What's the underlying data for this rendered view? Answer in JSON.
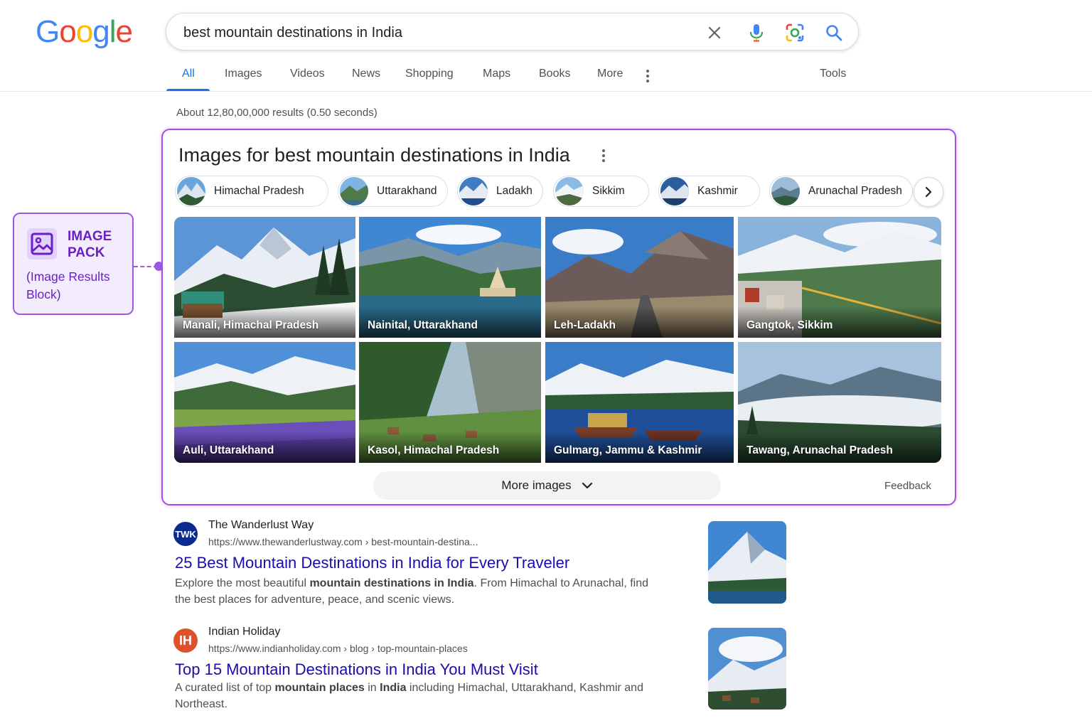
{
  "logo": {
    "letters": [
      "G",
      "o",
      "o",
      "g",
      "l",
      "e"
    ],
    "colors": [
      "#4285F4",
      "#EA4335",
      "#FBBC05",
      "#4285F4",
      "#34A853",
      "#EA4335"
    ]
  },
  "search": {
    "query": "best mountain destinations in India",
    "icons": [
      "close-icon",
      "mic-icon",
      "lens-icon",
      "search-icon"
    ]
  },
  "tabs": [
    "All",
    "Images",
    "Videos",
    "News",
    "Shopping",
    "Maps",
    "Books",
    "More"
  ],
  "tools_label": "Tools",
  "result_stats": "About 12,80,00,000 results (0.50 seconds)",
  "image_pack": {
    "title": "Images for best mountain destinations in India",
    "chips": [
      "Himachal Pradesh",
      "Uttarakhand",
      "Ladakh",
      "Sikkim",
      "Kashmir",
      "Arunachal Pradesh"
    ],
    "images": [
      "Manali, Himachal Pradesh",
      "Nainital, Uttarakhand",
      "Leh-Ladakh",
      "Gangtok, Sikkim",
      "Auli, Uttarakhand",
      "Kasol, Himachal Pradesh",
      "Gulmarg, Jammu & Kashmir",
      "Tawang, Arunachal Pradesh"
    ],
    "more_images": "More images",
    "feedback": "Feedback"
  },
  "callout": {
    "title_line1": "IMAGE",
    "title_line2": "PACK",
    "subtitle_line1": "(Image Results",
    "subtitle_line2": "Block)",
    "accent": "#9b59e0"
  },
  "results": [
    {
      "favicon_text": "TWK",
      "favicon_color": "#0b2a8f",
      "site": "The Wanderlust Way",
      "url": "https://www.thewanderlustway.com › best-mountain-destina...",
      "title": "25 Best Mountain Destinations in India for Every Traveler",
      "snippet_pre": "Explore the most beautiful ",
      "snippet_bold": "mountain destinations in India",
      "snippet_post": ". From Himachal to Arunachal, find the best places for adventure, peace, and scenic views."
    },
    {
      "favicon_text": "IH",
      "favicon_color": "#e0502b",
      "site": "Indian Holiday",
      "url": "https://www.indianholiday.com › blog › top-mountain-places",
      "title": "Top 15 Mountain Destinations in India You Must Visit",
      "snippet_pre": "A curated list of top ",
      "snippet_bold": "mountain places",
      "snippet_mid": " in ",
      "snippet_bold2": "India",
      "snippet_post": " including Himachal, Uttarakhand, Kashmir and Northeast."
    }
  ],
  "colors": {
    "link": "#1a0dab",
    "accent_tab": "#1a73e8",
    "pack_border": "#a44ee8"
  }
}
